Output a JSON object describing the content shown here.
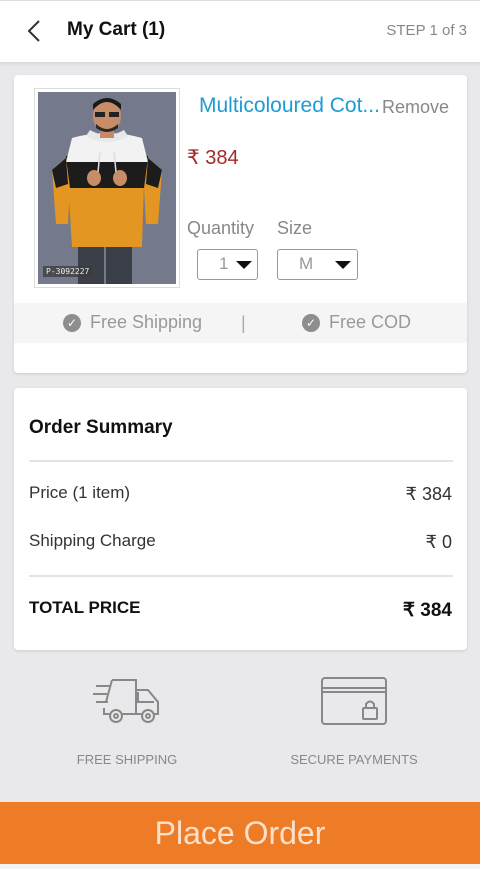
{
  "header": {
    "back_icon": "chevron-left-icon",
    "title": "My Cart (1)",
    "step": "STEP 1 of 3"
  },
  "product": {
    "sku": "P-3092227",
    "name": "Multicoloured Cotton Hoodie",
    "name_display": "Multicoloured Cot...",
    "remove_label": "Remove",
    "price": "₹ 384",
    "quantity_label": "Quantity",
    "quantity_value": "1",
    "size_label": "Size",
    "size_value": "M",
    "badges": {
      "free_shipping": "Free Shipping",
      "separator": "|",
      "free_cod": "Free COD"
    }
  },
  "order_summary": {
    "title": "Order Summary",
    "rows": [
      {
        "label": "Price (1 item)",
        "value": "₹ 384"
      },
      {
        "label": "Shipping Charge",
        "value": "₹ 0"
      }
    ],
    "total_label": "TOTAL PRICE",
    "total_value": "₹ 384"
  },
  "features": [
    {
      "icon": "delivery-truck-icon",
      "label": "FREE SHIPPING"
    },
    {
      "icon": "secure-card-icon",
      "label": "SECURE PAYMENTS"
    }
  ],
  "cta": {
    "label": "Place Order"
  },
  "colors": {
    "accent": "#ee7b26",
    "link": "#1e9ad6",
    "price": "#a22a2a",
    "background": "#e9e9eb"
  }
}
